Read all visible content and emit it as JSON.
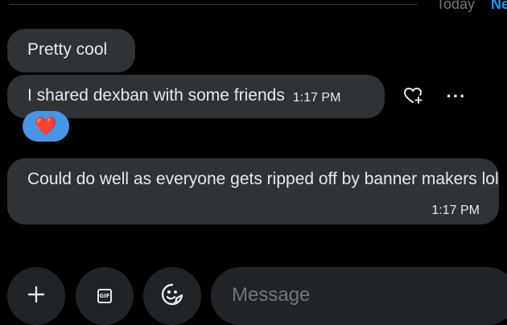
{
  "divider": {
    "label": "Today",
    "new_marker": "Ne"
  },
  "messages": [
    {
      "text": "Pretty cool"
    },
    {
      "text": "I shared dexban with some friends",
      "time": "1:17 PM",
      "reaction": "❤️"
    },
    {
      "text": "Could do well as everyone gets ripped off by banner makers lol",
      "time": "1:17 PM"
    }
  ],
  "actions": {
    "add_reaction_icon": "heart-plus-icon",
    "more_icon": "more-horizontal-icon",
    "more_glyph": "···"
  },
  "composer": {
    "placeholder": "Message",
    "value": "",
    "plus_icon": "plus-icon",
    "gif_icon": "gif-icon",
    "gif_label": "GIF",
    "emoji_icon": "emoji-icon"
  },
  "colors": {
    "background": "#000000",
    "bubble": "#2f3336",
    "composer": "#202327",
    "accent": "#1d9bf0",
    "reaction_bg": "#4a94e4",
    "muted_text": "#71767b"
  }
}
